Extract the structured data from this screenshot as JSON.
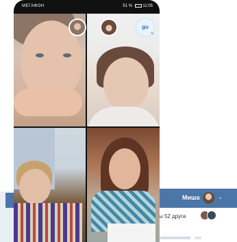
{
  "status_bar": {
    "carrier": "МЕГАФОН",
    "right": "51 %",
    "time": "11:05"
  },
  "call": {
    "participant_badge": "gu",
    "tiles": [
      {
        "name": "participant-1"
      },
      {
        "name": "participant-2"
      },
      {
        "name": "participant-3"
      },
      {
        "name": "participant-4"
      }
    ]
  },
  "background_app": {
    "header_name": "Миша",
    "friends_text": "ы 52 друга",
    "accent_color": "#4a76a8"
  },
  "icons": [
    "avatar-icon",
    "menu-chevron-icon",
    "battery-icon",
    "tools-icon"
  ]
}
